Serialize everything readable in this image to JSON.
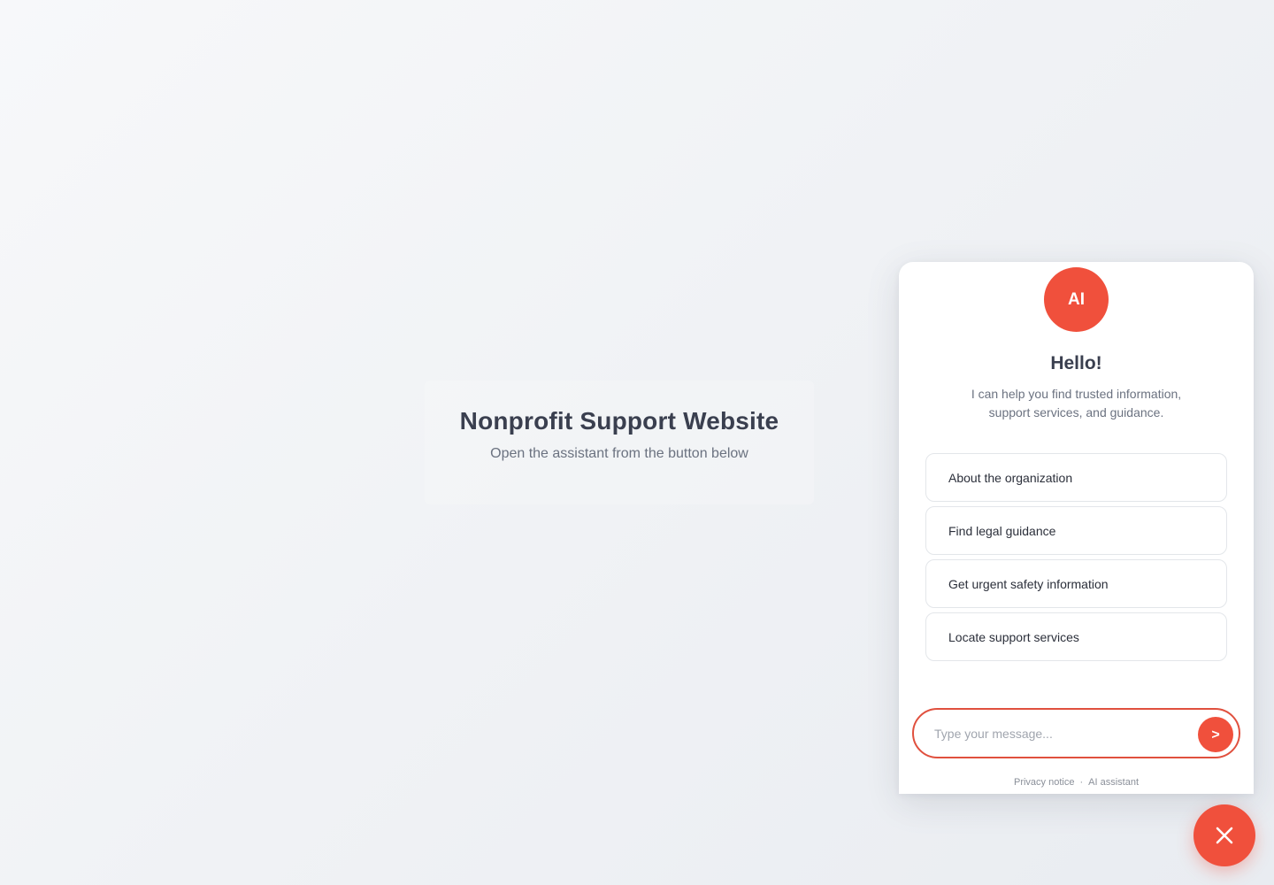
{
  "hero": {
    "title": "Nonprofit Support Website",
    "subtitle": "Open the assistant from the button below"
  },
  "chat": {
    "avatar_label": "AI",
    "greeting_title": "Hello!",
    "greeting_text": "I can help you find trusted information, support services, and guidance.",
    "options": [
      {
        "label": "About the organization"
      },
      {
        "label": "Find legal guidance"
      },
      {
        "label": "Get urgent safety information"
      },
      {
        "label": "Locate support services"
      }
    ],
    "input_placeholder": "Type your message...",
    "send_label": ">",
    "footer": {
      "privacy": "Privacy notice",
      "separator": "·",
      "assistant": "AI assistant"
    }
  },
  "fab": {
    "icon": "close-icon"
  },
  "colors": {
    "accent": "#f0503c",
    "text_dark": "#3a3f4f",
    "text_muted": "#6b7280"
  }
}
